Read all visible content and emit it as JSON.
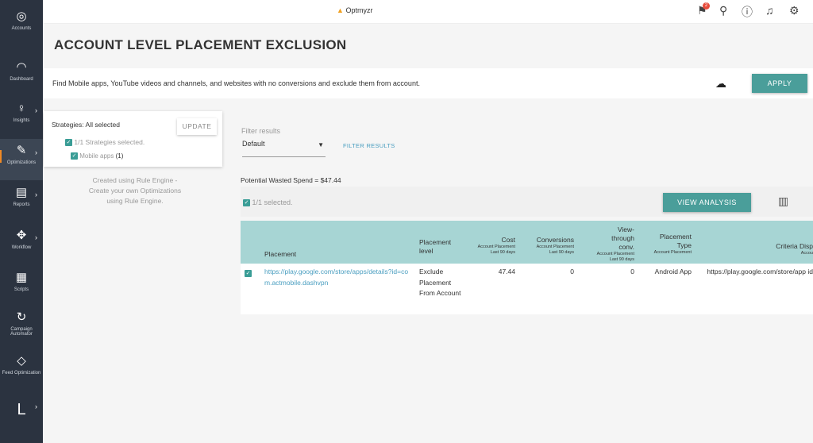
{
  "sidebar": {
    "items": [
      {
        "label": "Accounts",
        "icon": "accounts-icon",
        "glyph": "◎",
        "chevron": false
      },
      {
        "label": "Dashboard",
        "icon": "gauge-icon",
        "glyph": "◠",
        "chevron": false
      },
      {
        "label": "Insights",
        "icon": "lightbulb-icon",
        "glyph": "♀",
        "chevron": true
      },
      {
        "label": "Optimizations",
        "icon": "wrench-icon",
        "glyph": "✎",
        "chevron": true,
        "active": true
      },
      {
        "label": "Reports",
        "icon": "report-icon",
        "glyph": "▤",
        "chevron": true
      },
      {
        "label": "Workflow",
        "icon": "workflow-icon",
        "glyph": "✥",
        "chevron": true
      },
      {
        "label": "Scripts",
        "icon": "scripts-icon",
        "glyph": "▦",
        "chevron": false
      },
      {
        "label": "Campaign Automator",
        "icon": "automator-icon",
        "glyph": "↻",
        "chevron": false
      },
      {
        "label": "Feed Optimization",
        "icon": "tag-icon",
        "glyph": "◇",
        "chevron": false
      },
      {
        "label": "",
        "icon": "user-initial-icon",
        "glyph": "L",
        "chevron": true
      }
    ]
  },
  "topbar": {
    "logo": "Optmyzr",
    "notifications_badge": "2",
    "accent": "#4a9e9a"
  },
  "page": {
    "title": "ACCOUNT LEVEL PLACEMENT EXCLUSION",
    "description": "Find Mobile apps, YouTube videos and channels, and websites with no conversions and exclude them from account.",
    "apply_label": "APPLY"
  },
  "strategies": {
    "title": "Strategies: All selected",
    "update_label": "UPDATE",
    "selected": "1/1 Strategies selected.",
    "item": "Mobile apps",
    "item_count": "(1)",
    "note": [
      "Created using Rule Engine -",
      "Create your own Optimizations",
      "using Rule Engine."
    ]
  },
  "filter": {
    "label": "Filter results",
    "value": "Default",
    "button": "FILTER RESULTS"
  },
  "summary": {
    "wasted": "Potential Wasted Spend = $47.44",
    "selected": "1/1 selected.",
    "view_analysis": "VIEW ANALYSIS"
  },
  "table": {
    "headers": [
      {
        "title": "Placement",
        "sub": []
      },
      {
        "title": "Placement level",
        "sub": []
      },
      {
        "title": "Cost",
        "sub": [
          "Account Placement",
          "Last 90 days"
        ]
      },
      {
        "title": "Conversions",
        "sub": [
          "Account Placement",
          "Last 90 days"
        ]
      },
      {
        "title": "View-through conv.",
        "sub": [
          "Account Placement",
          "Last 90 days"
        ]
      },
      {
        "title": "Placement Type",
        "sub": [
          "Account Placement"
        ]
      },
      {
        "title": "Criteria Disp",
        "sub": [
          "Accou"
        ]
      }
    ],
    "rows": [
      {
        "placement": "https://play.google.com/store/apps/details?id=com.actmobile.dashvpn",
        "level": "Exclude Placement From Account",
        "cost": "47.44",
        "conversions": "0",
        "view_through": "0",
        "type": "Android App",
        "criteria": "https://play.google.com/store/app id=com.actmobil",
        "checked": true
      }
    ]
  }
}
